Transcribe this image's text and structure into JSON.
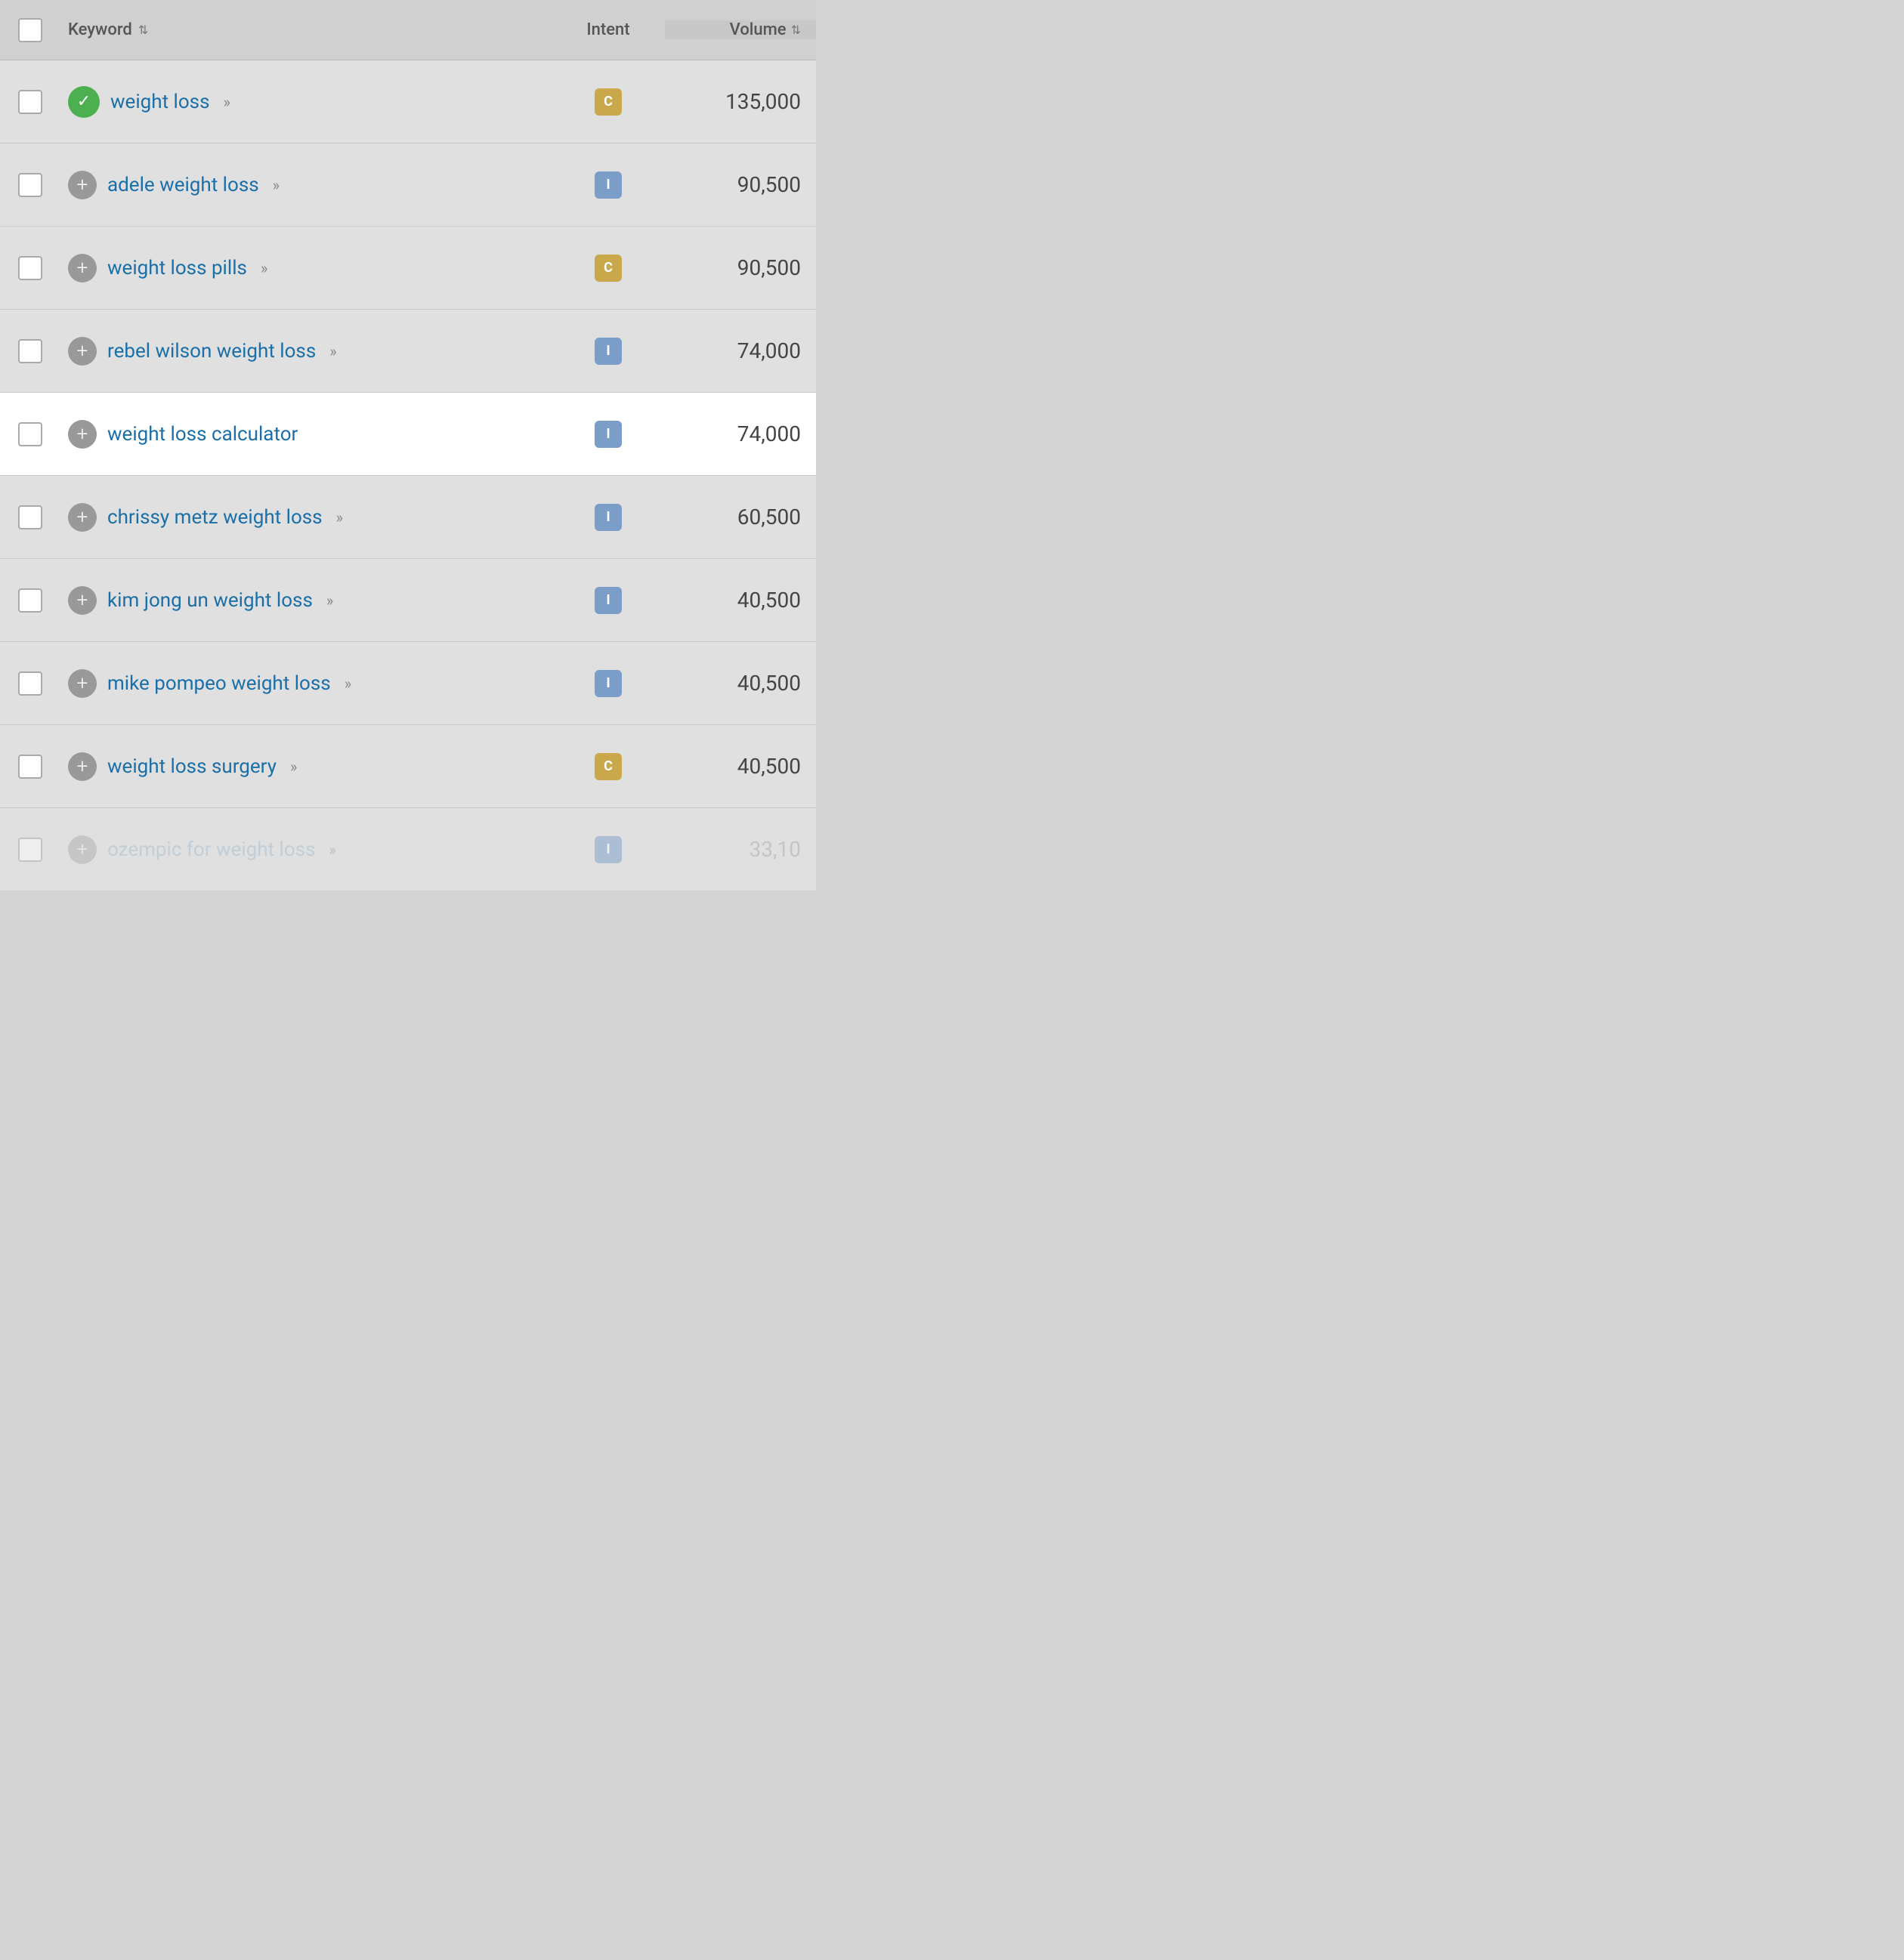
{
  "header": {
    "keyword_label": "Keyword",
    "intent_label": "Intent",
    "volume_label": "Volume"
  },
  "rows": [
    {
      "id": "weight-loss",
      "keyword": "weight loss",
      "has_chevron": true,
      "intent": "C",
      "intent_type": "c",
      "volume": "135,000",
      "checked": true,
      "highlighted": false,
      "faded": false
    },
    {
      "id": "adele-weight-loss",
      "keyword": "adele weight loss",
      "has_chevron": true,
      "intent": "I",
      "intent_type": "i",
      "volume": "90,500",
      "checked": false,
      "highlighted": false,
      "faded": false
    },
    {
      "id": "weight-loss-pills",
      "keyword": "weight loss pills",
      "has_chevron": true,
      "intent": "C",
      "intent_type": "c",
      "volume": "90,500",
      "checked": false,
      "highlighted": false,
      "faded": false
    },
    {
      "id": "rebel-wilson-weight-loss",
      "keyword": "rebel wilson weight loss",
      "has_chevron": true,
      "intent": "I",
      "intent_type": "i",
      "volume": "74,000",
      "checked": false,
      "highlighted": false,
      "faded": false
    },
    {
      "id": "weight-loss-calculator",
      "keyword": "weight loss calculator",
      "has_chevron": false,
      "intent": "I",
      "intent_type": "i",
      "volume": "74,000",
      "checked": false,
      "highlighted": true,
      "faded": false
    },
    {
      "id": "chrissy-metz-weight-loss",
      "keyword": "chrissy metz weight loss",
      "has_chevron": true,
      "intent": "I",
      "intent_type": "i",
      "volume": "60,500",
      "checked": false,
      "highlighted": false,
      "faded": false
    },
    {
      "id": "kim-jong-un-weight-loss",
      "keyword": "kim jong un weight loss",
      "has_chevron": true,
      "intent": "I",
      "intent_type": "i",
      "volume": "40,500",
      "checked": false,
      "highlighted": false,
      "faded": false
    },
    {
      "id": "mike-pompeo-weight-loss",
      "keyword": "mike pompeo weight loss",
      "has_chevron": true,
      "intent": "I",
      "intent_type": "i",
      "volume": "40,500",
      "checked": false,
      "highlighted": false,
      "faded": false
    },
    {
      "id": "weight-loss-surgery",
      "keyword": "weight loss surgery",
      "has_chevron": true,
      "intent": "C",
      "intent_type": "c",
      "volume": "40,500",
      "checked": false,
      "highlighted": false,
      "faded": false
    },
    {
      "id": "ozempic-for-weight-loss",
      "keyword": "ozempic for weight loss",
      "has_chevron": true,
      "intent": "I",
      "intent_type": "i",
      "volume": "33,10",
      "checked": false,
      "highlighted": false,
      "faded": true
    }
  ]
}
